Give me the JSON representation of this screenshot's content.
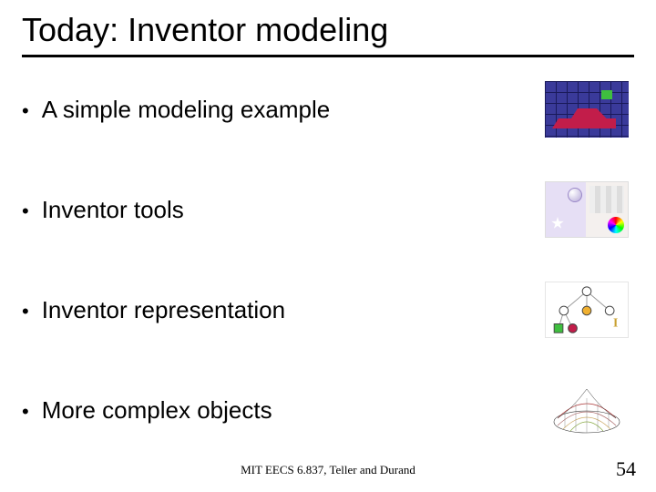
{
  "title": "Today: Inventor modeling",
  "bullets": [
    {
      "text": "A simple modeling example",
      "icon": "boat-grid-icon"
    },
    {
      "text": "Inventor tools",
      "icon": "tools-panel-icon"
    },
    {
      "text": "Inventor representation",
      "icon": "scene-graph-icon"
    },
    {
      "text": "More complex objects",
      "icon": "saddle-surface-icon"
    }
  ],
  "footer": "MIT EECS 6.837, Teller and Durand",
  "page_number": "54"
}
